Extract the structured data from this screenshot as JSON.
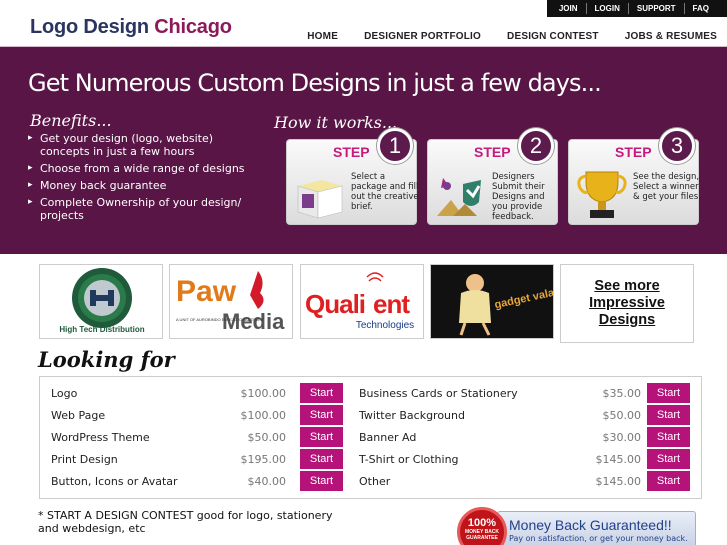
{
  "header": {
    "logo_part1": "Logo Design",
    "logo_part2": "Chicago",
    "top_links": [
      "JOIN",
      "LOGIN",
      "SUPPORT",
      "FAQ"
    ],
    "nav": [
      "HOME",
      "DESIGNER PORTFOLIO",
      "DESIGN CONTEST",
      "JOBS & RESUMES"
    ]
  },
  "banner": {
    "title": "Get Numerous Custom Designs in just a few days...",
    "benefits_title": "Benefits...",
    "benefits": [
      "Get your design (logo, website) concepts in just a few hours",
      "Choose from a wide range of designs",
      "Money back guarantee",
      "Complete Ownership of your design/ projects"
    ],
    "how_title": "How it works...",
    "steps": [
      {
        "word": "STEP",
        "num": "1",
        "text": "Select a package and fill out the creative brief."
      },
      {
        "word": "STEP",
        "num": "2",
        "text": "Designers Submit their Designs and you provide feedback."
      },
      {
        "word": "STEP",
        "num": "3",
        "text": "See the design, Select a winner & get your files."
      }
    ]
  },
  "portfolio": {
    "thumbs": [
      {
        "label": "High Tech Distribution"
      },
      {
        "label_big": "Paw",
        "label_media": "Media",
        "label_small": "A UNIT OF AUROBINDO EDUCATIONAL TRUST"
      },
      {
        "label_big": "Quali",
        "label_big2": "ent",
        "label_small": "Technologies"
      },
      {
        "label": "gadget vala.com"
      }
    ],
    "see_more": "See more Impressive Designs"
  },
  "looking_for": {
    "title": "Looking for",
    "left": [
      {
        "name": "Logo",
        "price": "$100.00",
        "button": "Start"
      },
      {
        "name": "Web Page",
        "price": "$100.00",
        "button": "Start"
      },
      {
        "name": "WordPress Theme",
        "price": "$50.00",
        "button": "Start"
      },
      {
        "name": "Print Design",
        "price": "$195.00",
        "button": "Start"
      },
      {
        "name": "Button, Icons or Avatar",
        "price": "$40.00",
        "button": "Start"
      }
    ],
    "right": [
      {
        "name": "Business Cards or Stationery",
        "price": "$35.00",
        "button": "Start"
      },
      {
        "name": "Twitter Background",
        "price": "$50.00",
        "button": "Start"
      },
      {
        "name": "Banner Ad",
        "price": "$30.00",
        "button": "Start"
      },
      {
        "name": "T-Shirt or Clothing",
        "price": "$145.00",
        "button": "Start"
      },
      {
        "name": "Other",
        "price": "$145.00",
        "button": "Start"
      }
    ]
  },
  "footer": {
    "contest_text": "* START A DESIGN CONTEST good for logo, stationery and webdesign, etc",
    "money_back_seal": "100%",
    "money_back_seal_sub": "MONEY BACK GUARANTEE",
    "money_back_title": "Money Back Guaranteed!!",
    "money_back_sub": "Pay on satisfaction, or get your money back."
  },
  "colors": {
    "brand_purple": "#581546",
    "accent_magenta": "#b5127a",
    "logo_navy": "#2a3560",
    "logo_maroon": "#8c1a5b"
  }
}
